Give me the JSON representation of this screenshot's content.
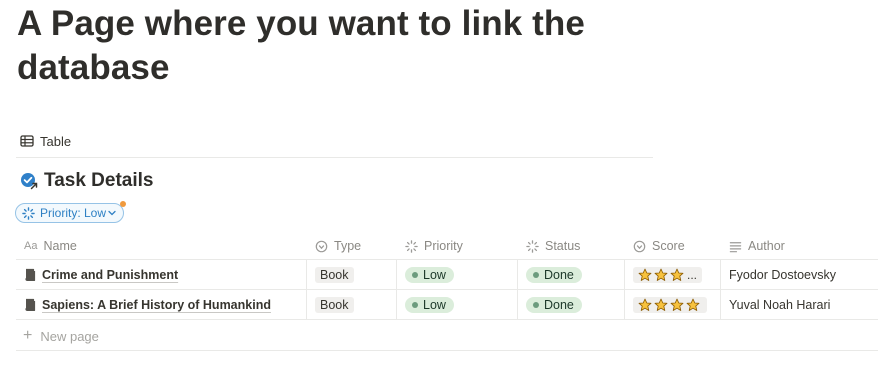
{
  "page": {
    "title": "A Page where you want to link the database"
  },
  "view": {
    "tab_label": "Table",
    "tab_icon": "table-icon"
  },
  "database": {
    "title": "Task Details",
    "icon": "database-link-icon"
  },
  "filter": {
    "label": "Priority: Low",
    "icon": "priority-loader-icon",
    "accent": "#2e80c4"
  },
  "table": {
    "columns": [
      {
        "label": "Name",
        "icon": "text-aa-icon"
      },
      {
        "label": "Type",
        "icon": "select-icon"
      },
      {
        "label": "Priority",
        "icon": "loader-icon"
      },
      {
        "label": "Status",
        "icon": "loader-icon"
      },
      {
        "label": "Score",
        "icon": "select-icon"
      },
      {
        "label": "Author",
        "icon": "text-lines-icon"
      }
    ],
    "rows": [
      {
        "name": "Crime and Punishment",
        "type": "Book",
        "priority": "Low",
        "status": "Done",
        "score_stars": 3,
        "score_truncated": "...",
        "author": "Fyodor Dostoevsky"
      },
      {
        "name": "Sapiens: A Brief History of Humankind",
        "type": "Book",
        "priority": "Low",
        "status": "Done",
        "score_stars": 4,
        "score_truncated": "",
        "author": "Yuval Noah Harari"
      }
    ],
    "new_page_label": "New page"
  },
  "colors": {
    "done_green": "#dbeddb",
    "star_yellow": "#f7c23e"
  }
}
